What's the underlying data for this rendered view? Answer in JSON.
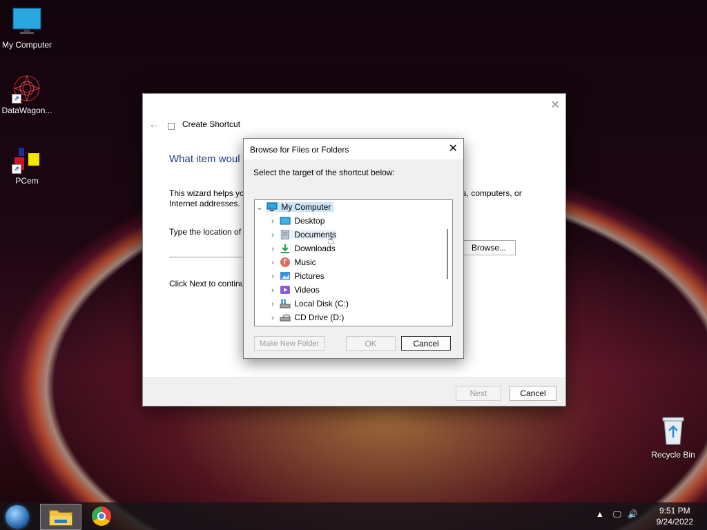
{
  "desktop": {
    "icons": [
      {
        "label": "My Computer"
      },
      {
        "label": "DataWagon..."
      },
      {
        "label": "PCem"
      },
      {
        "label": "Recycle Bin"
      }
    ]
  },
  "wizard": {
    "title": "Create Shortcut",
    "heading": "What item woul",
    "description_left": "This wizard helps you",
    "description_left_2": "Internet addresses.",
    "description_right": "ers, computers, or",
    "location_label": "Type the location of t",
    "browse_label": "Browse...",
    "continue_text": "Click Next to continu",
    "next_label": "Next",
    "cancel_label": "Cancel"
  },
  "browse_dialog": {
    "title": "Browse for Files or Folders",
    "instruction": "Select the target of the shortcut below:",
    "tree": [
      {
        "label": "My Computer",
        "icon": "monitor-icon",
        "expanded": true
      },
      {
        "label": "Desktop",
        "icon": "desktop-folder-icon"
      },
      {
        "label": "Documents",
        "icon": "documents-icon"
      },
      {
        "label": "Downloads",
        "icon": "download-icon"
      },
      {
        "label": "Music",
        "icon": "music-icon"
      },
      {
        "label": "Pictures",
        "icon": "pictures-icon"
      },
      {
        "label": "Videos",
        "icon": "videos-icon"
      },
      {
        "label": "Local Disk (C:)",
        "icon": "local-disk-icon"
      },
      {
        "label": "CD Drive (D:)",
        "icon": "cd-drive-icon"
      }
    ],
    "make_new_folder_label": "Make New Folder",
    "ok_label": "OK",
    "cancel_label": "Cancel"
  },
  "taskbar": {
    "time": "9:51 PM",
    "date": "9/24/2022"
  }
}
